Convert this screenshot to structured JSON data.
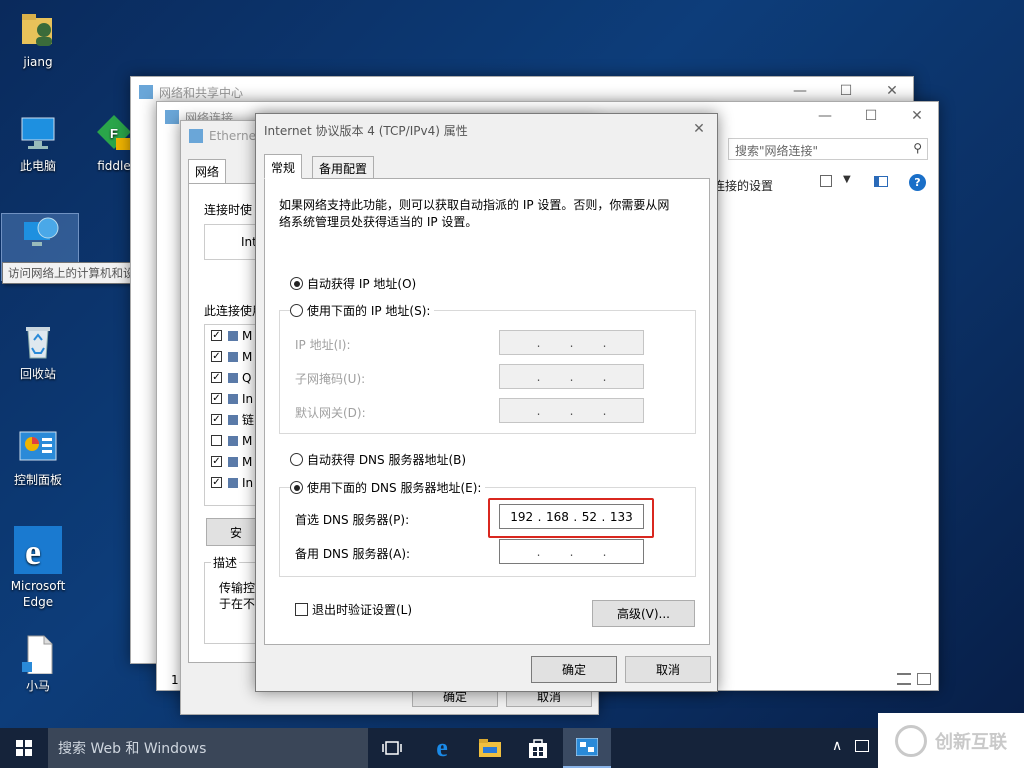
{
  "desktop": {
    "icons": [
      {
        "label": "jiang"
      },
      {
        "label": "此电脑"
      },
      {
        "label": "fiddle"
      },
      {
        "label": "回收站"
      },
      {
        "label": "控制面板"
      },
      {
        "label": "Microsoft Edge"
      },
      {
        "label": "小马"
      }
    ],
    "tooltip": "访问网络上的计算机和设备。"
  },
  "network_center": {
    "title": "网络和共享中心"
  },
  "network_connections": {
    "title": "网络连接",
    "search_placeholder": "搜索\"网络连接\"",
    "toolbar_text": "连接的设置"
  },
  "ethernet_props": {
    "title": "Ethernet",
    "tab": "网络",
    "connect_using": "连接时使",
    "adapter": "Int",
    "items_label": "此连接使用",
    "items": [
      {
        "text": "M",
        "checked": true
      },
      {
        "text": "M",
        "checked": true
      },
      {
        "text": "Q",
        "checked": true
      },
      {
        "text": "In",
        "checked": true
      },
      {
        "text": "链",
        "checked": true
      },
      {
        "text": "M",
        "checked": false
      },
      {
        "text": "M",
        "checked": true
      },
      {
        "text": "In",
        "checked": true
      }
    ],
    "install_btn": "安",
    "desc_label": "描述",
    "desc_line1": "传输控",
    "desc_line2": "于在不",
    "ok_btn": "确定",
    "cancel_btn": "取消",
    "num": "1"
  },
  "ipv4": {
    "title": "Internet 协议版本 4 (TCP/IPv4) 属性",
    "tabs": [
      "常规",
      "备用配置"
    ],
    "intro_line1": "如果网络支持此功能，则可以获取自动指派的 IP 设置。否则，你需要从网",
    "intro_line2": "络系统管理员处获得适当的 IP 设置。",
    "auto_ip": "自动获得 IP 地址(O)",
    "manual_ip": "使用下面的 IP 地址(S):",
    "ip_label": "IP 地址(I):",
    "mask_label": "子网掩码(U):",
    "gateway_label": "默认网关(D):",
    "auto_dns": "自动获得 DNS 服务器地址(B)",
    "manual_dns": "使用下面的 DNS 服务器地址(E):",
    "pref_dns_label": "首选 DNS 服务器(P):",
    "alt_dns_label": "备用 DNS 服务器(A):",
    "pref_dns": [
      "192",
      "168",
      "52",
      "133"
    ],
    "validate": "退出时验证设置(L)",
    "advanced": "高级(V)...",
    "ok": "确定",
    "cancel": "取消"
  },
  "taskbar": {
    "search": "搜索 Web 和 Windows",
    "watermark": "创新互联"
  },
  "colors": {
    "highlight_red": "#d9271f",
    "taskbar": "#15233a"
  }
}
